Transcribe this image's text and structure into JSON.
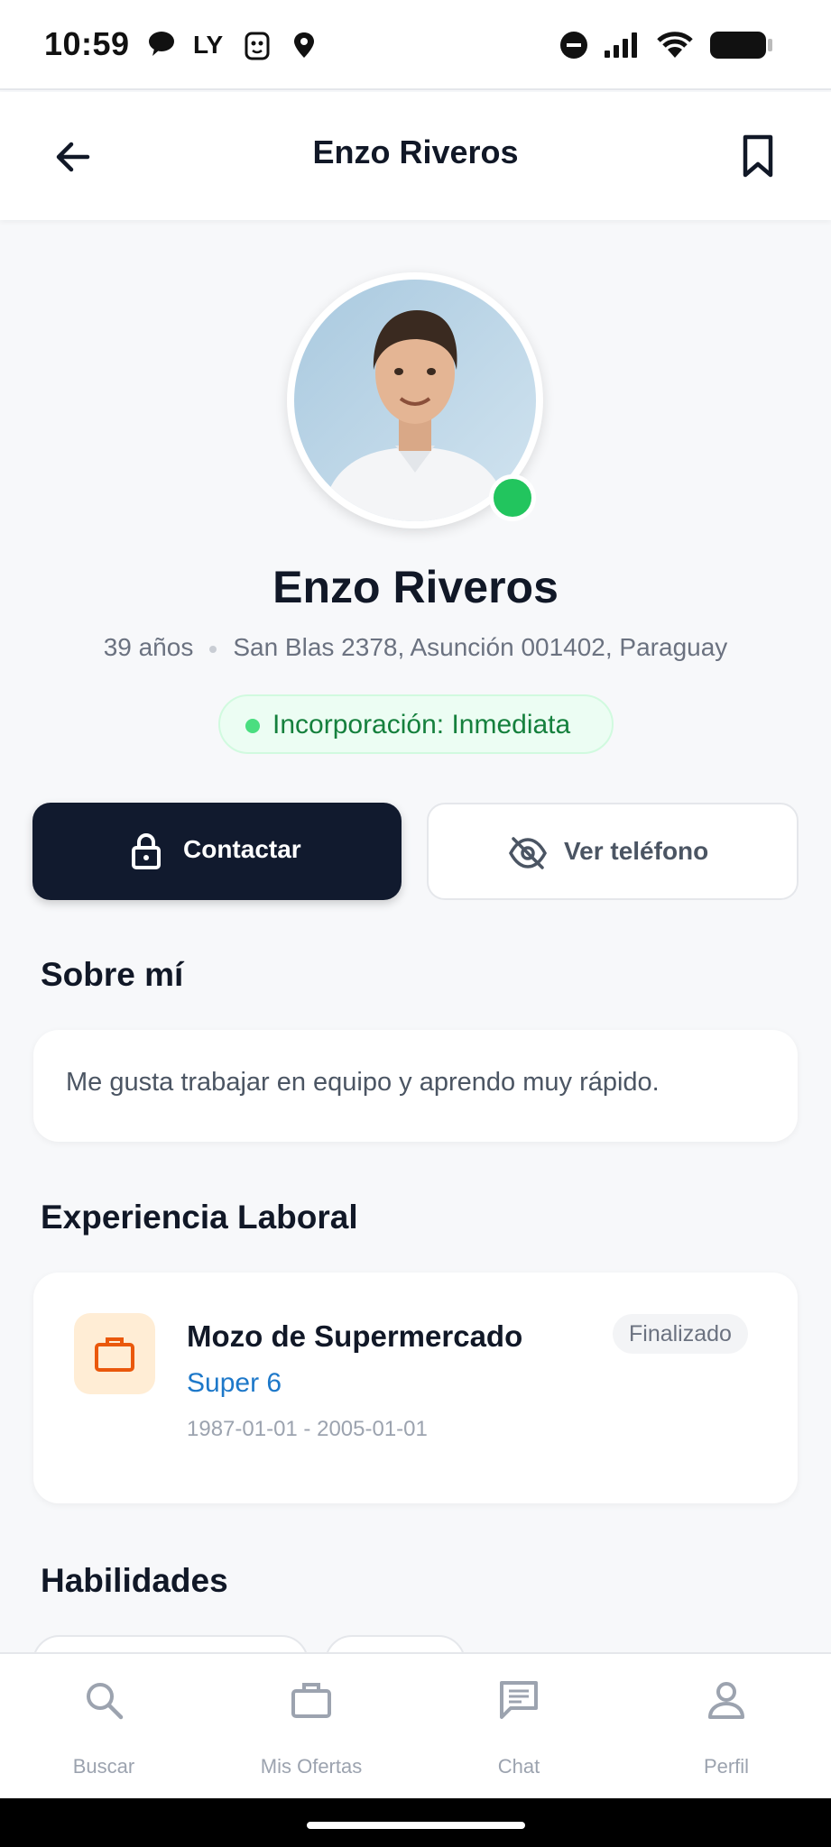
{
  "status_bar": {
    "time": "10:59",
    "carrier": "LY"
  },
  "header": {
    "title": "Enzo Riveros"
  },
  "profile": {
    "name": "Enzo Riveros",
    "age": "39 años",
    "address": "San Blas 2378, Asunción 001402, Paraguay",
    "availability": "Incorporación: Inmediata"
  },
  "actions": {
    "contact_label": "Contactar",
    "phone_label": "Ver teléfono"
  },
  "about": {
    "title": "Sobre mí",
    "text": "Me gusta trabajar en equipo y aprendo muy rápido."
  },
  "experience": {
    "title": "Experiencia Laboral",
    "items": [
      {
        "role": "Mozo de Supermercado",
        "company": "Super 6",
        "dates": "1987-01-01 - 2005-01-01",
        "status": "Finalizado"
      }
    ]
  },
  "skills": {
    "title": "Habilidades"
  },
  "nav": {
    "items": [
      {
        "label": "Buscar",
        "icon": "search-icon"
      },
      {
        "label": "Mis Ofertas",
        "icon": "briefcase-icon"
      },
      {
        "label": "Chat",
        "icon": "chat-icon"
      },
      {
        "label": "Perfil",
        "icon": "person-icon"
      }
    ]
  },
  "colors": {
    "primary_dark": "#111a2e",
    "online": "#22c55e",
    "company_link": "#1d78c9",
    "availability_text": "#15803d"
  }
}
